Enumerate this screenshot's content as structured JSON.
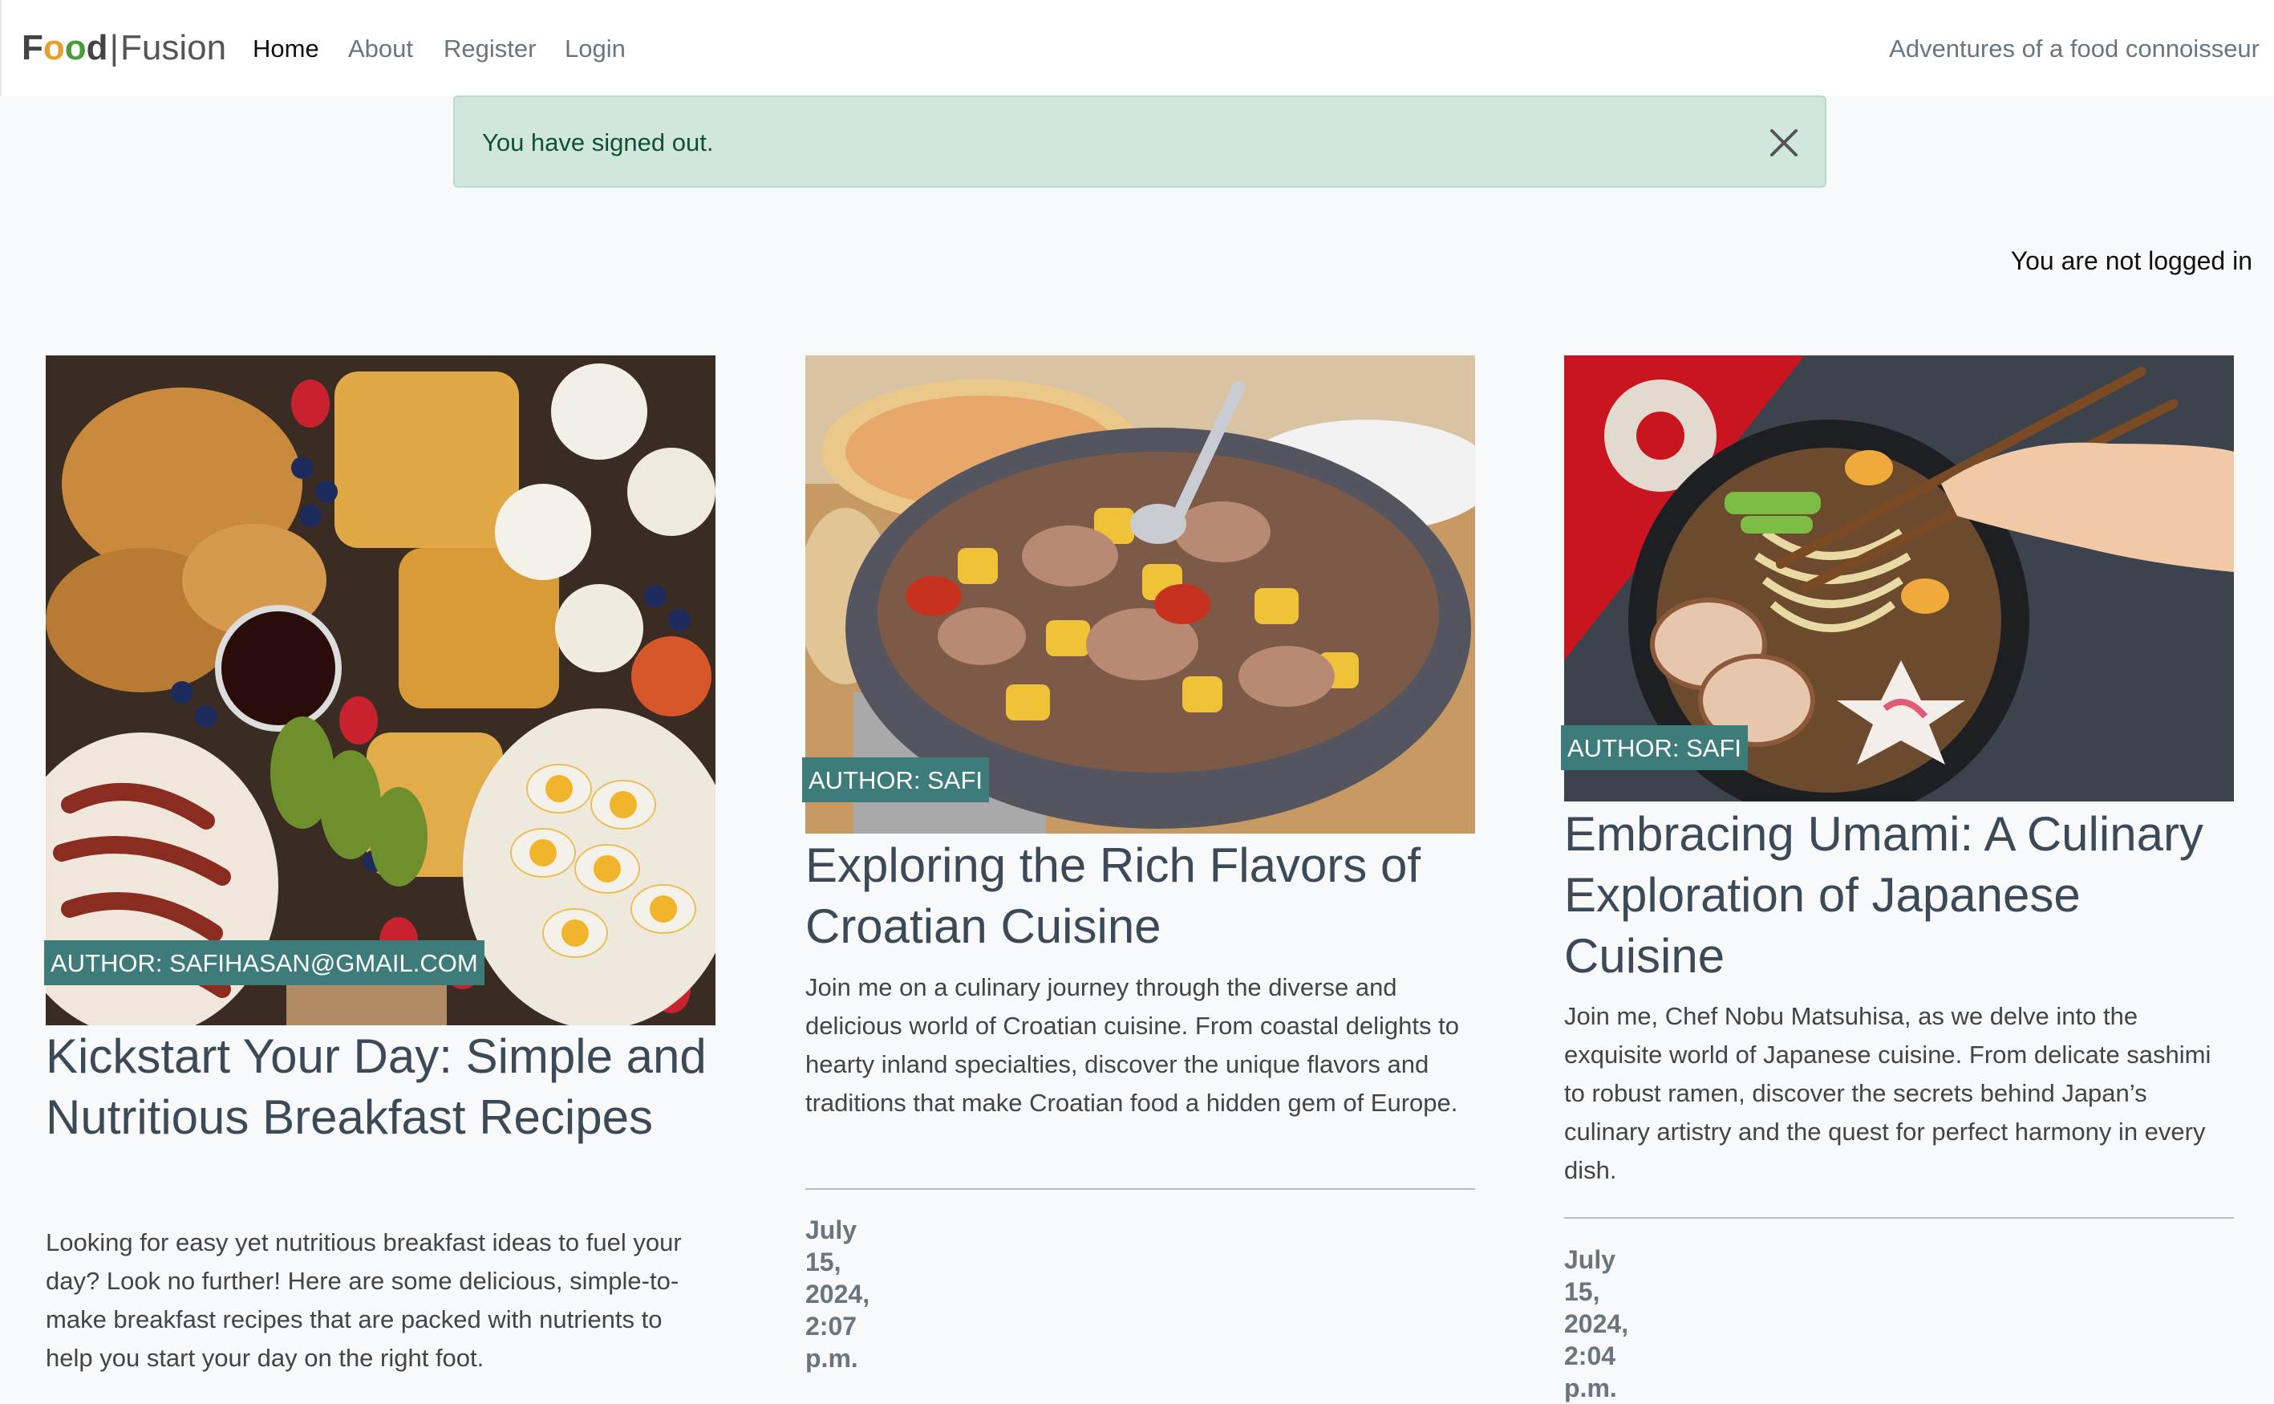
{
  "navbar": {
    "brand_food": "Food",
    "brand_separator": "|",
    "brand_fusion": "Fusion",
    "links": [
      {
        "label": "Home",
        "active": true
      },
      {
        "label": "About",
        "active": false
      },
      {
        "label": "Register",
        "active": false
      },
      {
        "label": "Login",
        "active": false
      }
    ],
    "tagline": "Adventures of a food connoisseur"
  },
  "alert": {
    "message": "You have signed out.",
    "close_icon": "close-icon"
  },
  "login_status": "You are not logged in",
  "posts": [
    {
      "author_badge": "Author: safihasan@gmail.com",
      "title": "Kickstart Your Day: Simple and Nutritious Breakfast Recipes",
      "excerpt": "Looking for easy yet nutritious breakfast ideas to fuel your day? Look no further! Here are some delicious, simple-to-make breakfast recipes that are packed with nutrients to help you start your day on the right foot.",
      "date": "",
      "image": "breakfast-platter-image"
    },
    {
      "author_badge": "Author: Safi",
      "title": "Exploring the Rich Flavors of Croatian Cuisine",
      "excerpt": "Join me on a culinary journey through the diverse and delicious world of Croatian cuisine. From coastal delights to hearty inland specialties, discover the unique flavors and traditions that make Croatian food a hidden gem of Europe.",
      "date": "July 15, 2024, 2:07 p.m.",
      "image": "croatian-dish-image"
    },
    {
      "author_badge": "Author: Safi",
      "title": "Embracing Umami: A Culinary Exploration of Japanese Cuisine",
      "excerpt": "Join me, Chef Nobu Matsuhisa, as we delve into the exquisite world of Japanese cuisine. From delicate sashimi to robust ramen, discover the secrets behind Japan’s culinary artistry and the quest for perfect harmony in every dish.",
      "date": "July 15, 2024, 2:04 p.m.",
      "image": "ramen-bowl-image"
    }
  ],
  "colors": {
    "badge_bg": "#3e7b7b",
    "alert_bg": "#d1e7dd",
    "alert_text": "#0f5132",
    "page_bg": "#f8f9fa"
  }
}
